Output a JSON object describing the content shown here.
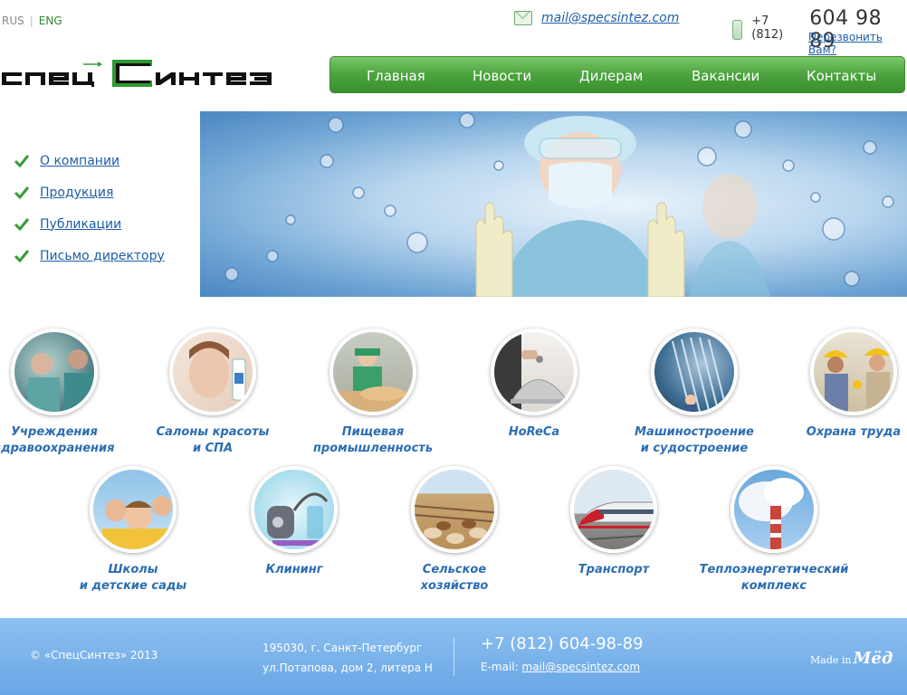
{
  "header": {
    "lang_rus": "RUS",
    "lang_sep": "|",
    "lang_eng": "ENG",
    "email": "mail@specsintez.com",
    "phone_code": "+7 (812)",
    "phone_number": "604 98 89",
    "callback": "Перезвонить Вам?"
  },
  "logo": {
    "text": "СпецСинтез"
  },
  "nav": {
    "items": [
      "Главная",
      "Новости",
      "Дилерам",
      "Вакансии",
      "Контакты"
    ]
  },
  "sidebar": {
    "items": [
      "О компании",
      "Продукция",
      "Публикации",
      "Письмо директору"
    ]
  },
  "categories": [
    {
      "label": "Учреждения\nздравоохранения"
    },
    {
      "label": "Салоны красоты\nи СПА"
    },
    {
      "label": "Пищевая\nпромышленность"
    },
    {
      "label": "HoReCa"
    },
    {
      "label": "Машиностроение\nи судостроение"
    },
    {
      "label": "Охрана труда"
    },
    {
      "label": "Школы\nи детские сады"
    },
    {
      "label": "Клининг"
    },
    {
      "label": "Сельское\nхозяйство"
    },
    {
      "label": "Транспорт"
    },
    {
      "label": "Теплоэнергетический\nкомплекс"
    }
  ],
  "footer": {
    "copyright": "© «СпецСинтез» 2013",
    "address_line1": "195030, г. Санкт-Петербург",
    "address_line2": "ул.Потапова, дом 2, литера Н",
    "phone": "+7 (812) 604-98-89",
    "email_label": "E-mail:",
    "email": "mail@specsintez.com",
    "made_in": "Made in",
    "made_brand": "Мёд"
  },
  "colors": {
    "accent_green": "#4ba33e",
    "link_blue": "#1d5ea8",
    "category_blue": "#2a6db3",
    "footer_blue": "#7ab3ec"
  }
}
